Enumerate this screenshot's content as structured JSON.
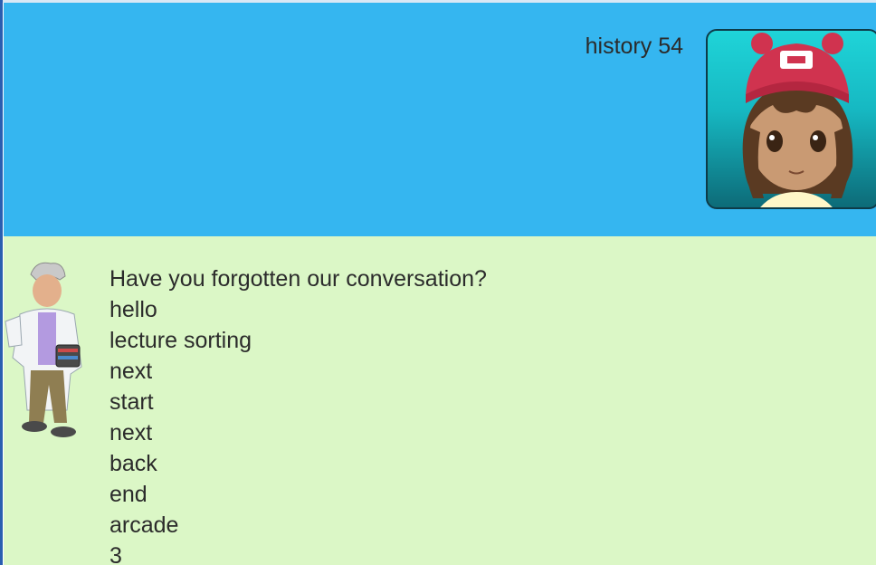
{
  "user_message": {
    "text": "history 54",
    "avatar_icon": "girl-trainer-avatar-icon"
  },
  "bot_message": {
    "avatar_icon": "professor-avatar-icon",
    "lines": [
      "Have you forgotten our conversation?",
      "hello",
      "lecture sorting",
      "next",
      "start",
      "next",
      "back",
      "end",
      "arcade",
      "3"
    ]
  },
  "colors": {
    "user_bubble": "#35b6f0",
    "bot_bubble": "#dbf7c6",
    "text": "#2b2b2b"
  }
}
